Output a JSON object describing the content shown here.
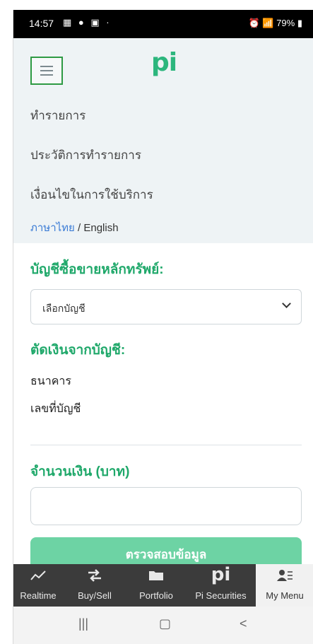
{
  "status_bar": {
    "time": "14:57",
    "battery": "79%"
  },
  "header": {
    "logo_text": "pi"
  },
  "menu": {
    "items": [
      {
        "label": "ทำรายการ"
      },
      {
        "label": "ประวัติการทำรายการ"
      },
      {
        "label": "เงื่อนไขในการใช้บริการ"
      }
    ],
    "language_thai": "ภาษาไทย",
    "language_separator": " / ",
    "language_english": "English"
  },
  "form": {
    "account_section_title": "บัญชีซื้อขายหลักทรัพย์:",
    "account_select_value": "เลือกบัญชี",
    "debit_section_title": "ตัดเงินจากบัญชี:",
    "bank_label": "ธนาคาร",
    "account_number_label": "เลขที่บัญชี",
    "amount_section_title": "จำนวนเงิน (บาท)",
    "amount_value": "",
    "verify_button_label": "ตรวจสอบข้อมูล"
  },
  "bottom_nav": {
    "items": [
      {
        "label": "Realtime",
        "icon": "line-chart-icon"
      },
      {
        "label": "Buy/Sell",
        "icon": "exchange-arrows-icon"
      },
      {
        "label": "Portfolio",
        "icon": "folder-icon"
      },
      {
        "label": "Pi Securities",
        "icon": "pi-logo-icon"
      },
      {
        "label": "My Menu",
        "icon": "user-menu-icon"
      }
    ],
    "active_index": 4
  },
  "colors": {
    "accent": "#1fa86a",
    "button": "#6dd3a4",
    "nav_bg": "#3b3b3b",
    "menu_bg": "#eef3f5",
    "link": "#3a7bd5"
  }
}
